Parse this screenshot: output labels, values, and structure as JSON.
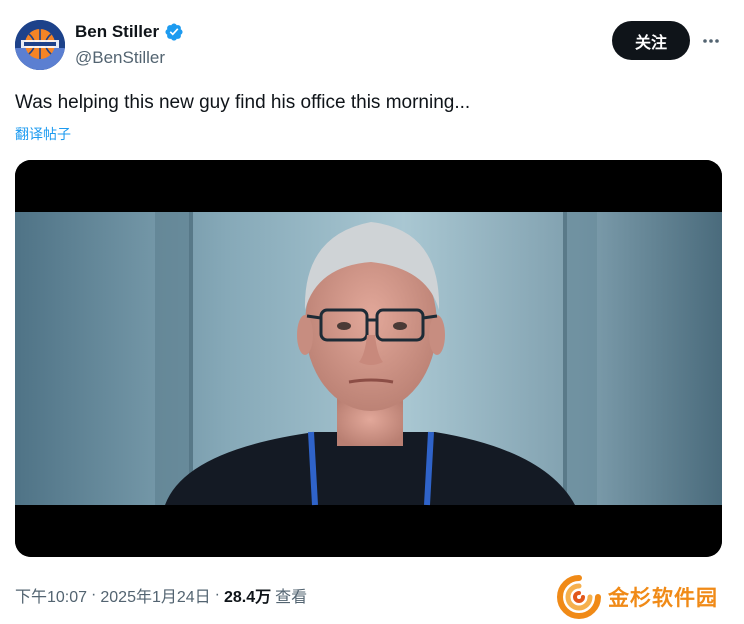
{
  "tweet": {
    "author": {
      "display_name": "Ben Stiller",
      "handle": "@BenStiller",
      "verified": true,
      "verified_color": "#1d9bf0"
    },
    "follow_label": "关注",
    "more_icon": "more-dots-icon",
    "text": "Was helping this new guy find his office this morning...",
    "translate_label": "翻译帖子",
    "media_kind": "video-still",
    "meta": {
      "time": "下午10:07",
      "separator": "·",
      "date": "2025年1月24日",
      "views": "28.4万",
      "views_label": "查看"
    }
  },
  "watermark": {
    "text": "金杉软件园",
    "color": "#f08a17"
  },
  "colors": {
    "text_primary": "#0f1419",
    "text_secondary": "#536471",
    "link": "#1d9bf0"
  }
}
